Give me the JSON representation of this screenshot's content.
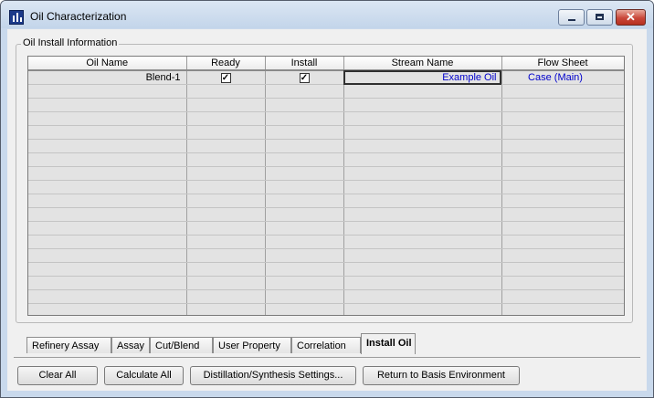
{
  "window": {
    "title": "Oil  Characterization"
  },
  "group": {
    "label": "Oil Install Information"
  },
  "grid": {
    "columns": [
      "Oil Name",
      "Ready",
      "Install",
      "Stream Name",
      "Flow Sheet"
    ],
    "rows": [
      {
        "oil_name": "Blend-1",
        "ready": true,
        "install": true,
        "stream_name": "Example Oil",
        "flow_sheet": "Case (Main)"
      }
    ]
  },
  "tabs": [
    "Refinery Assay",
    "Assay",
    "Cut/Blend",
    "User Property",
    "Correlation",
    "Install Oil"
  ],
  "active_tab": "Install Oil",
  "buttons": {
    "clear_all": "Clear All",
    "calculate_all": "Calculate All",
    "distillation_settings": "Distillation/Synthesis Settings...",
    "return_basis": "Return to Basis Environment"
  },
  "colors": {
    "link": "#0000cc",
    "titlebar": "#c9d9ec",
    "close_button": "#c9473a"
  }
}
